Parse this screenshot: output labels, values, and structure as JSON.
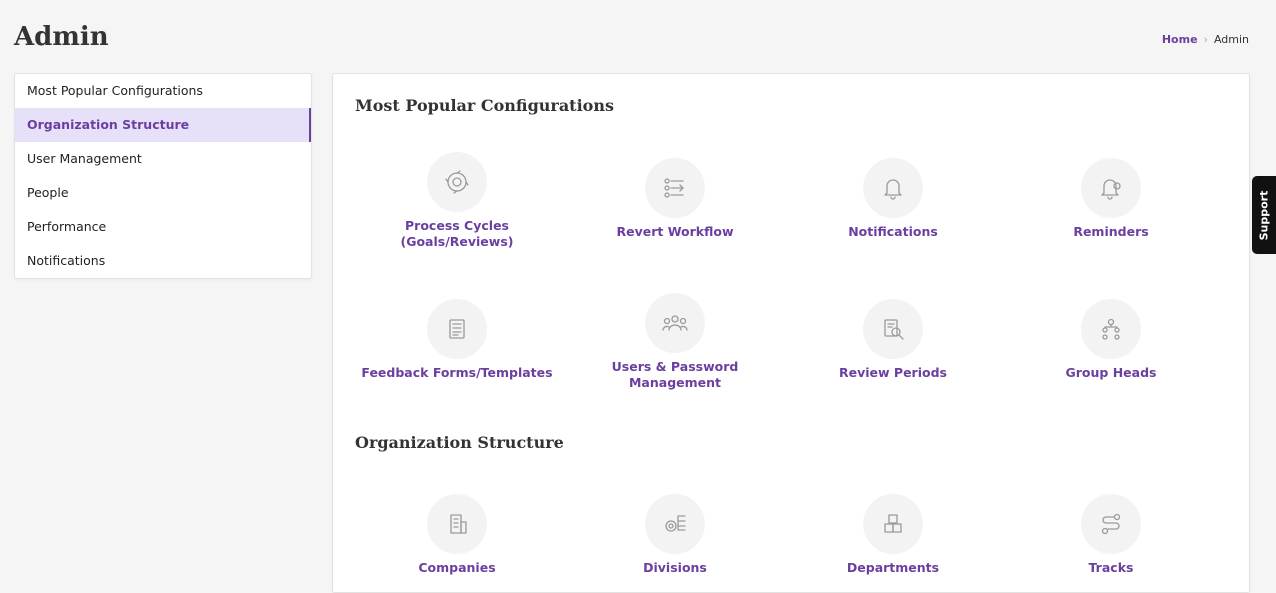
{
  "page": {
    "title": "Admin"
  },
  "breadcrumb": {
    "home": "Home",
    "current": "Admin"
  },
  "sidebar": {
    "items": [
      {
        "label": "Most Popular Configurations"
      },
      {
        "label": "Organization Structure",
        "active": true
      },
      {
        "label": "User Management"
      },
      {
        "label": "People"
      },
      {
        "label": "Performance"
      },
      {
        "label": "Notifications"
      }
    ]
  },
  "sections": {
    "popular": {
      "title": "Most Popular Configurations",
      "tiles": [
        {
          "label_line1": "Process Cycles",
          "label_line2": "(Goals/Reviews)",
          "icon": "cycle-icon"
        },
        {
          "label_line1": "Revert Workflow",
          "icon": "workflow-icon"
        },
        {
          "label_line1": "Notifications",
          "icon": "bell-icon"
        },
        {
          "label_line1": "Reminders",
          "icon": "reminder-bell-icon"
        },
        {
          "label_line1": "Feedback Forms/Templates",
          "icon": "form-template-icon"
        },
        {
          "label_line1": "Users & Password",
          "label_line2": "Management",
          "icon": "users-icon"
        },
        {
          "label_line1": "Review Periods",
          "icon": "review-search-icon"
        },
        {
          "label_line1": "Group Heads",
          "icon": "hierarchy-icon"
        }
      ]
    },
    "org": {
      "title": "Organization Structure",
      "tiles": [
        {
          "label_line1": "Companies",
          "icon": "building-icon"
        },
        {
          "label_line1": "Divisions",
          "icon": "gear-list-icon"
        },
        {
          "label_line1": "Departments",
          "icon": "cubes-icon"
        },
        {
          "label_line1": "Tracks",
          "icon": "track-path-icon"
        }
      ]
    }
  },
  "support": {
    "label": "Support"
  },
  "colors": {
    "accent": "#6b3fa0",
    "active_bg": "#e6e1f9",
    "icon_bg": "#f3f3f3"
  }
}
